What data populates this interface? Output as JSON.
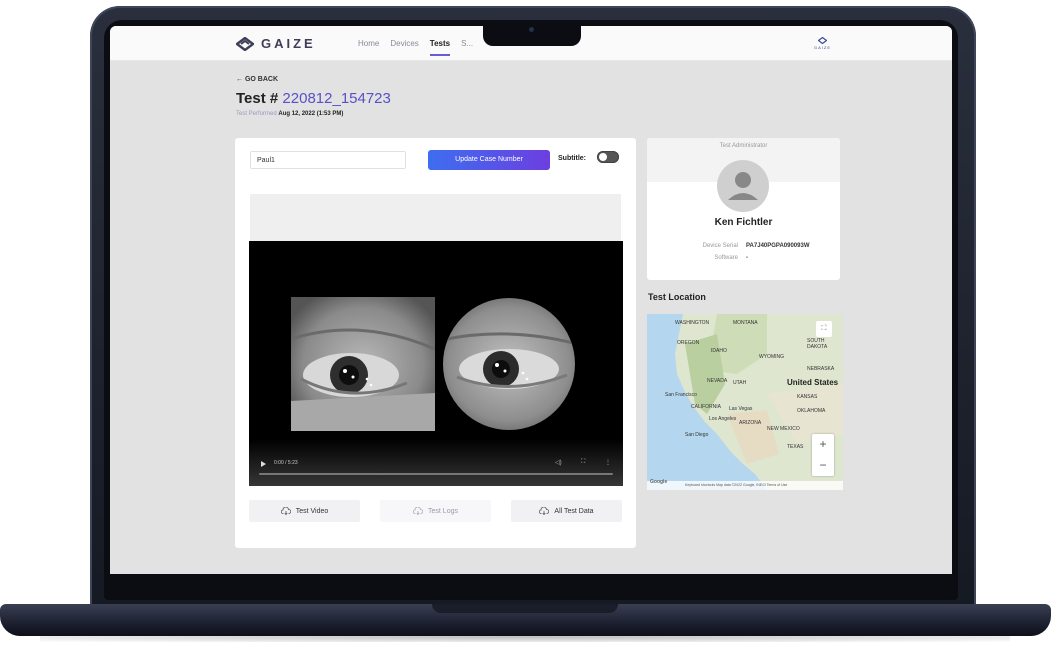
{
  "app": {
    "brand": "GAIZE",
    "corner_brand": "GAIZE",
    "nav": [
      "Home",
      "Devices",
      "Tests",
      "S..."
    ]
  },
  "page": {
    "back_label": "← GO BACK",
    "title_prefix": "Test #",
    "test_id": "220812_154723",
    "performed_label": "Test Performed",
    "performed_value": "Aug 12, 2022 (1:53 PM)"
  },
  "case": {
    "input_value": "Paul1",
    "update_button": "Update Case Number",
    "subtitle_label": "Subtitle:",
    "subtitle_on": false
  },
  "video": {
    "time": "0:00 / 5:23",
    "progress": 0
  },
  "downloads": {
    "video": "Test Video",
    "logs": "Test Logs",
    "all": "All Test Data"
  },
  "admin": {
    "header": "Test Administrator",
    "name": "Ken Fichtler",
    "serial_label": "Device Serial",
    "serial_value": "PA7J40PGPA090093W",
    "software_label": "Software",
    "software_value": "-"
  },
  "location": {
    "title": "Test Location",
    "country": "United States",
    "cities": [
      "San Francisco",
      "Las Vegas",
      "Los Angeles",
      "San Diego",
      "NEVADA",
      "UTAH",
      "CALIFORNIA",
      "ARIZONA",
      "NEW MEXICO",
      "WYOMING",
      "NEBRASKA",
      "KANSAS",
      "OKLAHOMA",
      "MONTANA",
      "NORTH DAKOTA",
      "SOUTH DAKOTA",
      "WASHINGTON",
      "OREGON",
      "IDAHO",
      "TEXAS"
    ],
    "map_footer": "Keyboard shortcuts   Map data ©2022 Google, INEGI   Terms of Use",
    "google": "Google",
    "zoom_in": "+",
    "zoom_out": "−",
    "fullscreen": "⛶"
  },
  "colors": {
    "accent": "#5850c8",
    "button_gradient_start": "#3d6ef0",
    "button_gradient_end": "#6c3fe0",
    "laptop": "#1c2030"
  }
}
